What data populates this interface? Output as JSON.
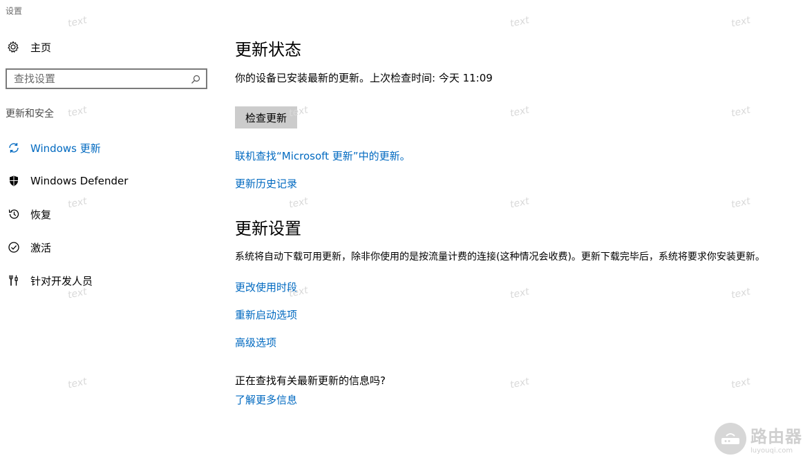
{
  "window": {
    "title": "设置"
  },
  "sidebar": {
    "home_label": "主页",
    "search_placeholder": "查找设置",
    "section_label": "更新和安全",
    "items": [
      {
        "label": "Windows 更新",
        "icon": "refresh-icon",
        "active": true
      },
      {
        "label": "Windows Defender",
        "icon": "shield-icon",
        "active": false
      },
      {
        "label": "恢复",
        "icon": "history-icon",
        "active": false
      },
      {
        "label": "激活",
        "icon": "check-circle-icon",
        "active": false
      },
      {
        "label": "针对开发人员",
        "icon": "developer-tools-icon",
        "active": false
      }
    ]
  },
  "main": {
    "status_title": "更新状态",
    "status_text": "你的设备已安装最新的更新。上次检查时间: 今天 11:09",
    "check_button": "检查更新",
    "online_link": "联机查找“Microsoft 更新”中的更新。",
    "history_link": "更新历史记录",
    "settings_title": "更新设置",
    "settings_desc": "系统将自动下载可用更新，除非你使用的是按流量计费的连接(这种情况会收费)。更新下载完毕后，系统将要求你安装更新。",
    "active_hours_link": "更改使用时段",
    "restart_link": "重新启动选项",
    "advanced_link": "高级选项",
    "info_question": "正在查找有关最新更新的信息吗?",
    "learn_more_link": "了解更多信息"
  },
  "watermark": {
    "text": "text"
  },
  "logo": {
    "name": "路由器",
    "domain": "luyouqi.com"
  },
  "colors": {
    "accent": "#0069c0",
    "button_bg": "#cccccc"
  }
}
